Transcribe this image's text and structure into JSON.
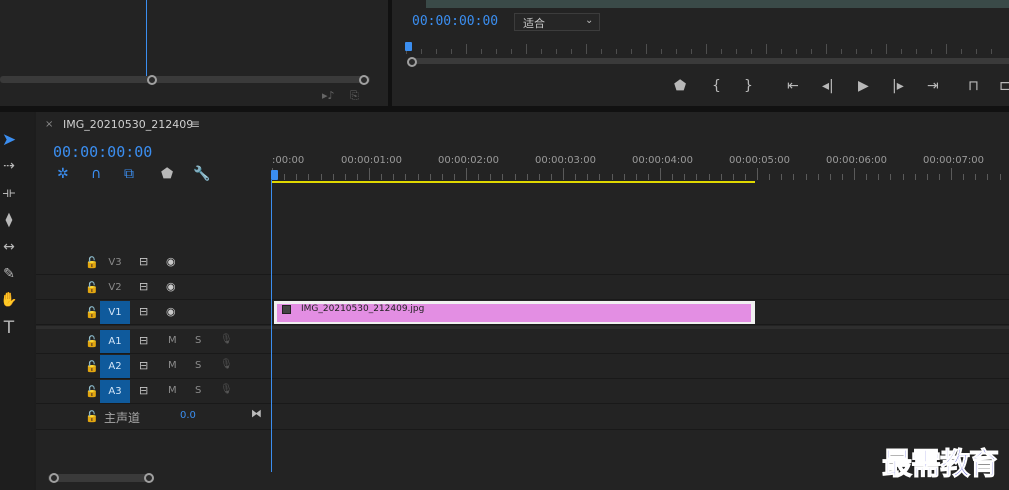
{
  "program_monitor": {
    "timecode": "00:00:00:00",
    "fit_select": "适合"
  },
  "timeline": {
    "tab_title": "IMG_20210530_212409",
    "timecode": "00:00:00:00",
    "ruler_labels": [
      ":00:00",
      "00:00:01:00",
      "00:00:02:00",
      "00:00:03:00",
      "00:00:04:00",
      "00:00:05:00",
      "00:00:06:00",
      "00:00:07:00"
    ],
    "video_tracks": [
      {
        "name": "V3",
        "targeted": false
      },
      {
        "name": "V2",
        "targeted": false
      },
      {
        "name": "V1",
        "targeted": true
      }
    ],
    "audio_tracks": [
      {
        "name": "A1",
        "m": "M",
        "s": "S"
      },
      {
        "name": "A2",
        "m": "M",
        "s": "S"
      },
      {
        "name": "A3",
        "m": "M",
        "s": "S"
      }
    ],
    "master": {
      "label": "主声道",
      "value": "0.0"
    },
    "clip": {
      "name": "IMG_20210530_212409.jpg",
      "color": "#e38ee3"
    }
  },
  "watermark": "最需教育",
  "colors": {
    "accent": "#3b8ef0",
    "work_area": "#e0d800"
  }
}
